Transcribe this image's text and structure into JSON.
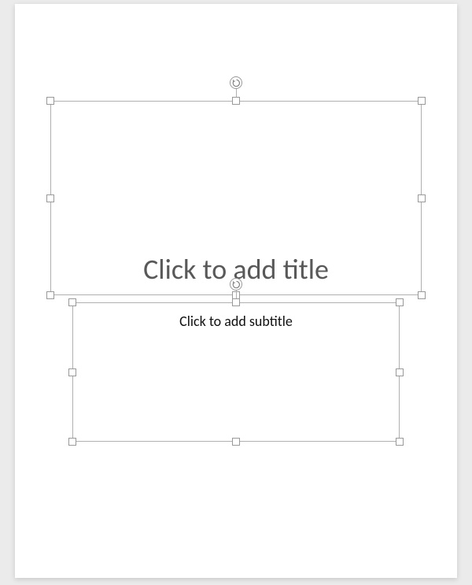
{
  "slide": {
    "title_placeholder": "Click to add title",
    "subtitle_placeholder": "Click to add subtitle"
  },
  "colors": {
    "canvas_bg": "#ebebeb",
    "slide_bg": "#ffffff",
    "selection_border": "#b0b0b0",
    "handle_bg": "#ffffff",
    "handle_border": "#999999",
    "title_placeholder_color": "#595959",
    "subtitle_placeholder_color": "#111111"
  }
}
